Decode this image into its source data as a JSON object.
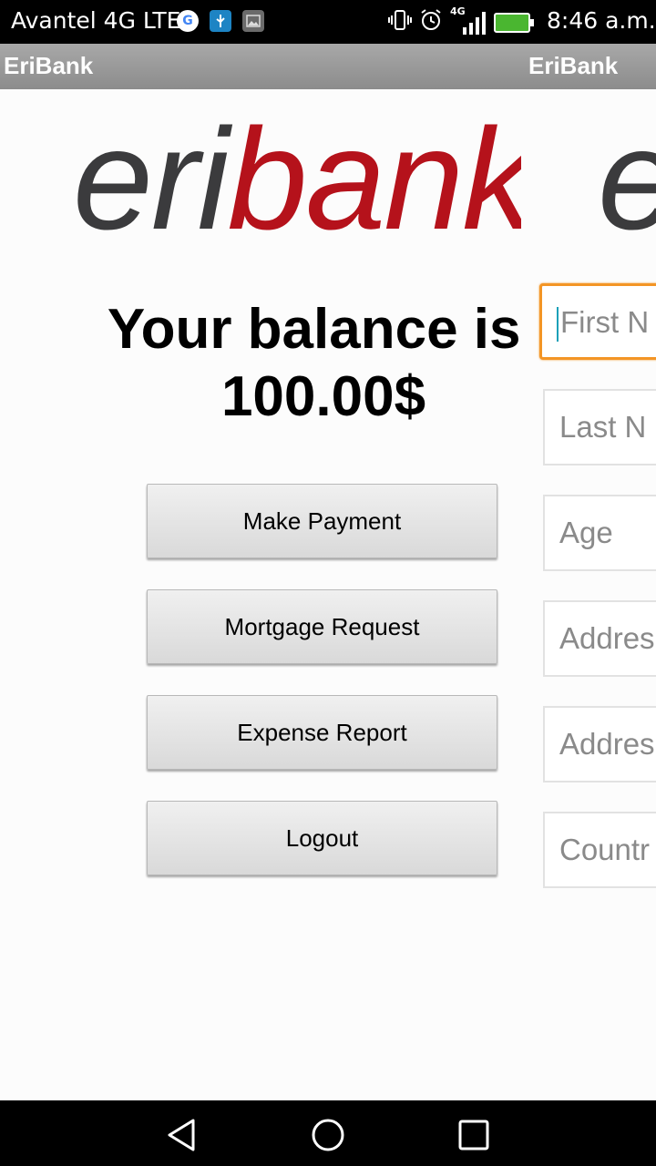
{
  "status_bar": {
    "carrier": "Avantel 4G LTE",
    "network_badge": "4G",
    "time": "8:46 a.m.",
    "icons": [
      "google-icon",
      "usb-icon",
      "gallery-icon",
      "vibrate-icon",
      "alarm-icon",
      "signal-icon",
      "battery-charging-icon"
    ]
  },
  "left_screen": {
    "title": "EriBank",
    "logo": {
      "part1": "eri",
      "part2": "bank"
    },
    "balance_label": "Your balance is:",
    "balance_value": "100.00$",
    "buttons": {
      "make_payment": "Make Payment",
      "mortgage_request": "Mortgage Request",
      "expense_report": "Expense Report",
      "logout": "Logout"
    }
  },
  "right_screen": {
    "title": "EriBank",
    "logo_partial": "e",
    "fields": {
      "first_name": "First N",
      "last_name": "Last N",
      "age": "Age",
      "address1": "Addres",
      "address2": "Addres",
      "country": "Countr"
    }
  },
  "colors": {
    "brand_red": "#b5121b",
    "brand_gray": "#3b3b3d",
    "focus_orange": "#f39525"
  },
  "nav_bar": {
    "buttons": [
      "back-icon",
      "home-icon",
      "recents-icon"
    ]
  }
}
